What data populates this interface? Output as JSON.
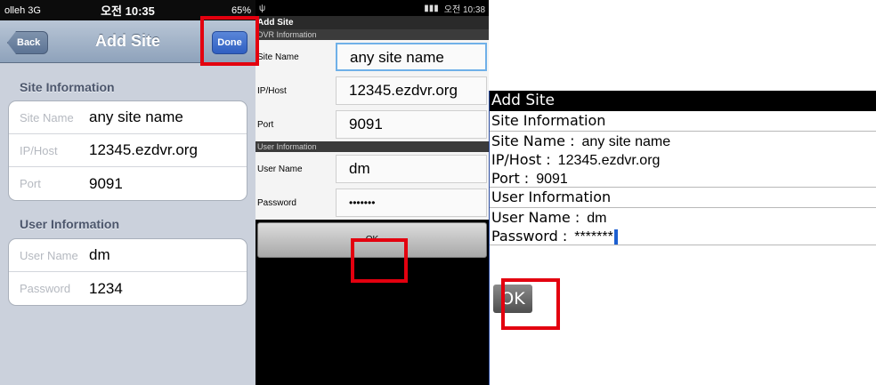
{
  "ios": {
    "status": {
      "carrier": "olleh 3G",
      "time": "오전 10:35",
      "battery": "65%"
    },
    "nav": {
      "back": "Back",
      "title": "Add Site",
      "done": "Done"
    },
    "site_section": "Site Information",
    "site_fields": [
      {
        "label": "Site Name",
        "value": "any site name"
      },
      {
        "label": "IP/Host",
        "value": "12345.ezdvr.org"
      },
      {
        "label": "Port",
        "value": "9091"
      }
    ],
    "user_section": "User Information",
    "user_fields": [
      {
        "label": "User Name",
        "value": "dm"
      },
      {
        "label": "Password",
        "value": "1234"
      }
    ]
  },
  "android": {
    "status": {
      "time": "오전 10:38"
    },
    "title": "Add Site",
    "dvr_section": "DVR Information",
    "dvr_fields": [
      {
        "label": "Site Name",
        "value": "any site name"
      },
      {
        "label": "IP/Host",
        "value": "12345.ezdvr.org"
      },
      {
        "label": "Port",
        "value": "9091"
      }
    ],
    "user_section": "User Information",
    "user_fields": [
      {
        "label": "User Name",
        "value": "dm"
      },
      {
        "label": "Password",
        "value": "•••••••"
      }
    ],
    "ok": "OK"
  },
  "blackberry": {
    "title": "Add Site",
    "site_section": "Site Information",
    "site_name": {
      "label": "Site Name :",
      "value": "any site name"
    },
    "ip_host": {
      "label": "IP/Host :",
      "value": "12345.ezdvr.org"
    },
    "port": {
      "label": "Port :",
      "value": "9091"
    },
    "user_section": "User Information",
    "user_name": {
      "label": "User Name :",
      "value": "dm"
    },
    "password": {
      "label": "Password :",
      "value": "*******"
    },
    "ok": "OK"
  },
  "highlight_color": "#e3000f"
}
